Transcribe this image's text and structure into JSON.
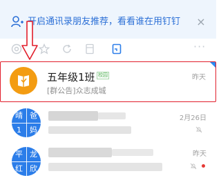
{
  "banner": {
    "text": "开启通讯录朋友推荐，看看谁在用钉钉",
    "close_symbol": "×",
    "icon": "add-contact-icon"
  },
  "tabs": {
    "more_symbol": "···",
    "items": [
      {
        "icon": "at-mention-icon",
        "active": false
      },
      {
        "icon": "star-icon",
        "active": false
      },
      {
        "icon": "refresh-icon",
        "active": false
      },
      {
        "icon": "note-icon",
        "active": false
      },
      {
        "icon": "document-icon",
        "active": true
      }
    ]
  },
  "chats": [
    {
      "title": "五年级1班",
      "badge": "校园",
      "subtitle": "[群公告]众志成城",
      "time": "昨天",
      "avatar_icon": "document-group-icon",
      "selected": true
    },
    {
      "avatar_chars": [
        "晴",
        "爸",
        "1",
        "妈"
      ],
      "time": "2月26日",
      "muted": true
    },
    {
      "avatar_chars": [
        "平",
        "龙",
        "红",
        "欣"
      ],
      "time": "昨天",
      "muted": true,
      "unread_dot": true
    }
  ],
  "colors": {
    "accent_blue": "#2b7de9",
    "annotation_red": "#e11d2a",
    "banner_bg": "#eef5fd",
    "avatar_orange": "#f39c12"
  }
}
